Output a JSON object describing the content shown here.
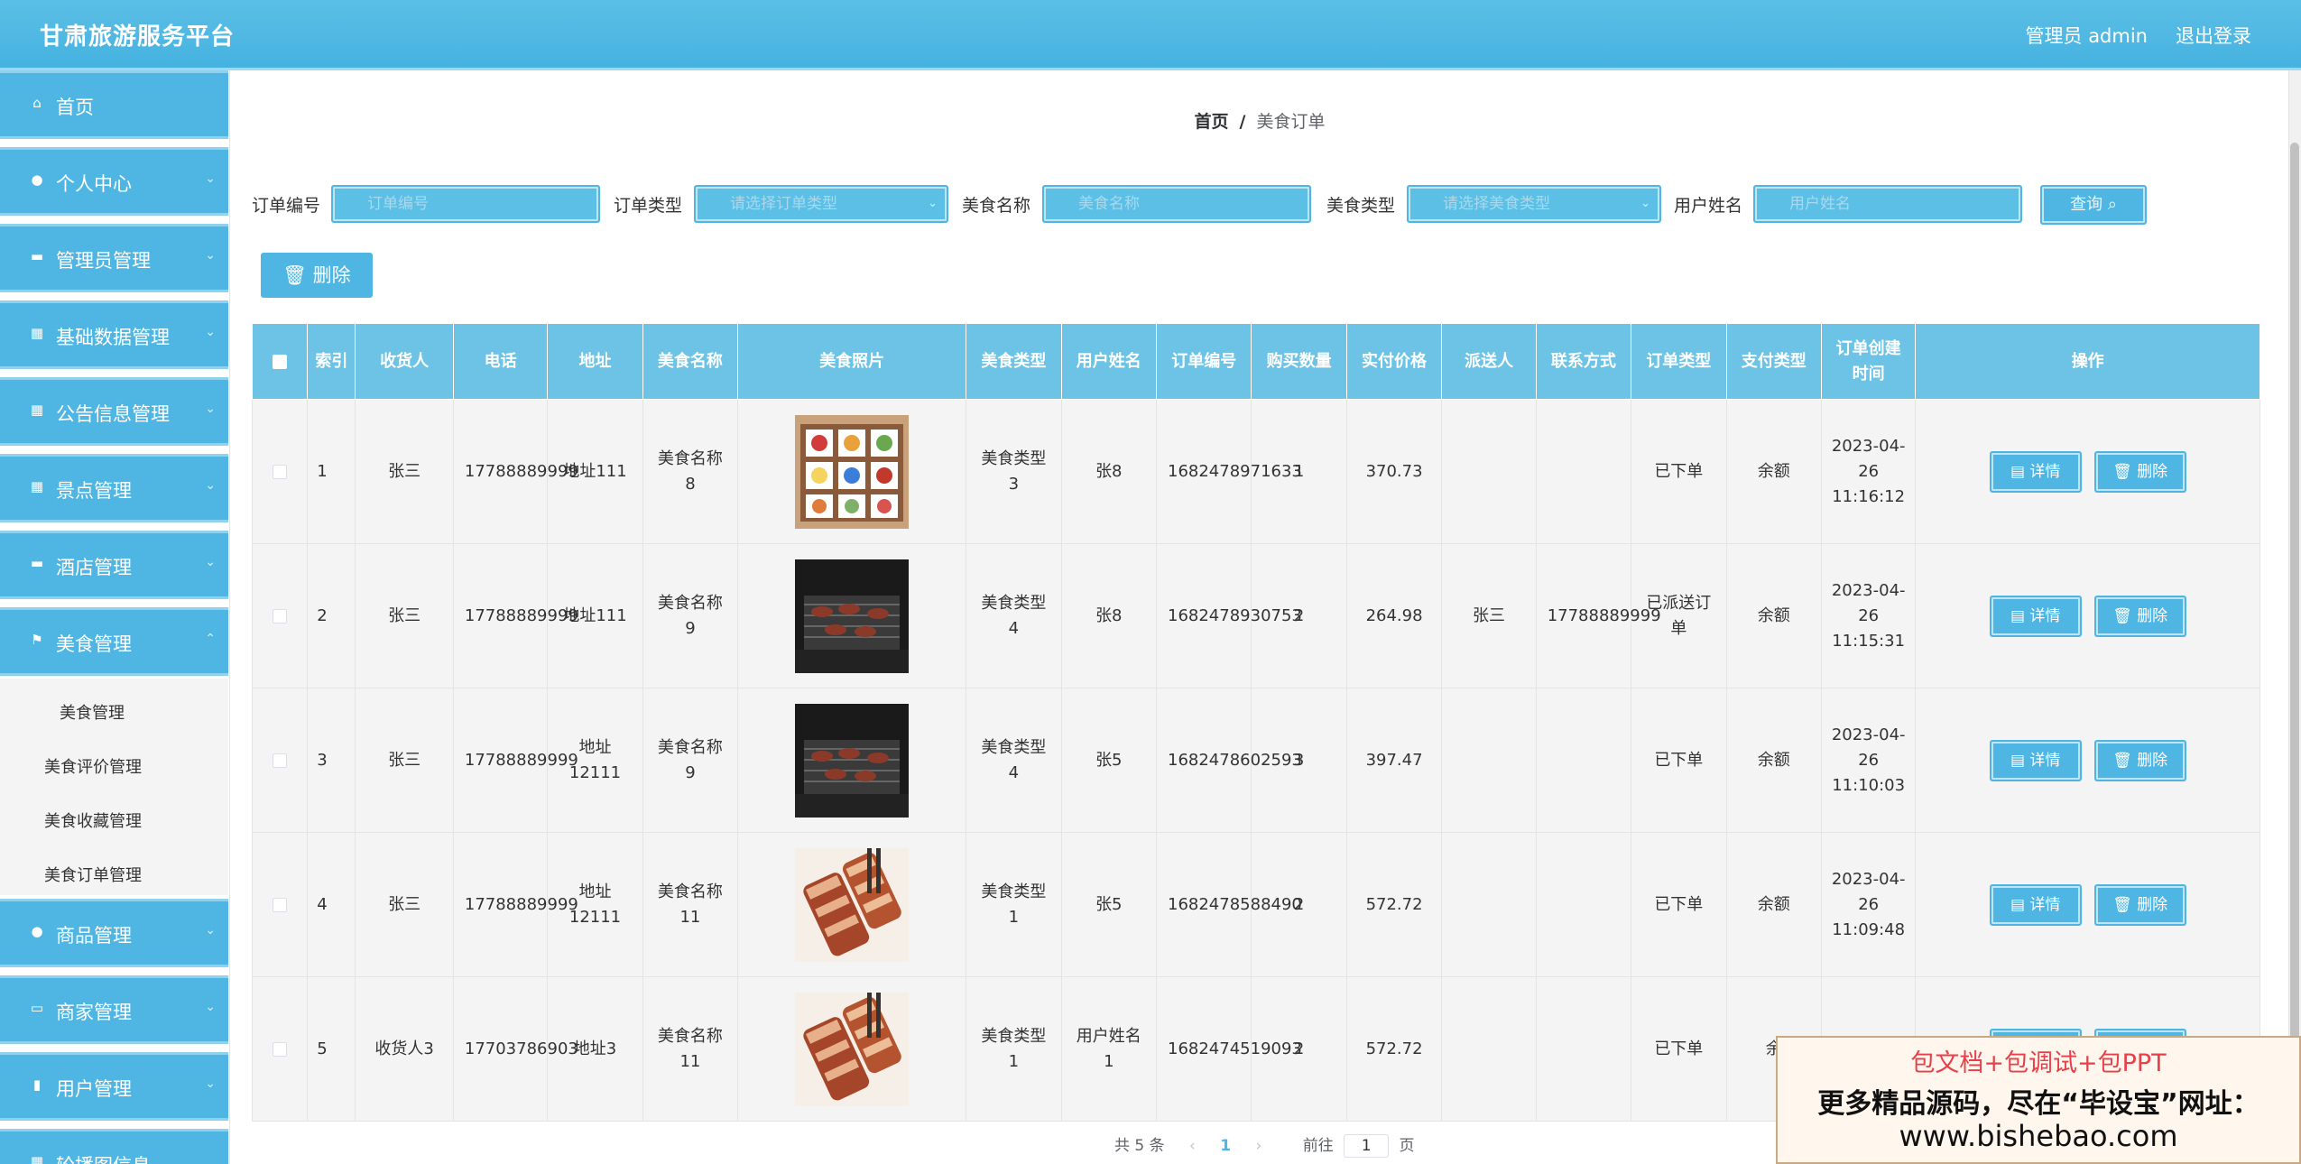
{
  "header": {
    "brand": "甘肃旅游服务平台",
    "user": "管理员 admin",
    "logout": "退出登录"
  },
  "sidebar": {
    "items": [
      {
        "label": "首页",
        "icon": "home-icon",
        "glyph": "⌂"
      },
      {
        "label": "个人中心",
        "icon": "user-icon",
        "glyph": "●"
      },
      {
        "label": "管理员管理",
        "icon": "briefcase-icon",
        "glyph": "▬"
      },
      {
        "label": "基础数据管理",
        "icon": "grid-icon",
        "glyph": "▦"
      },
      {
        "label": "公告信息管理",
        "icon": "grid-icon",
        "glyph": "▦"
      },
      {
        "label": "景点管理",
        "icon": "grid-icon",
        "glyph": "▦"
      },
      {
        "label": "酒店管理",
        "icon": "briefcase-icon",
        "glyph": "▬"
      },
      {
        "label": "美食管理",
        "icon": "flag-icon",
        "glyph": "⚑"
      },
      {
        "label": "商品管理",
        "icon": "circle-icon",
        "glyph": "●"
      },
      {
        "label": "商家管理",
        "icon": "monitor-icon",
        "glyph": "▭"
      },
      {
        "label": "用户管理",
        "icon": "bar-chart-icon",
        "glyph": "▮"
      },
      {
        "label": "轮播图信息",
        "icon": "image-icon",
        "glyph": "▦"
      }
    ],
    "sub_items": [
      "美食管理",
      "美食评价管理",
      "美食收藏管理",
      "美食订单管理"
    ]
  },
  "breadcrumb": {
    "home": "首页",
    "sep": "/",
    "current": "美食订单"
  },
  "filters": {
    "order_no_label": "订单编号",
    "order_no_placeholder": "订单编号",
    "order_type_label": "订单类型",
    "order_type_placeholder": "请选择订单类型",
    "food_name_label": "美食名称",
    "food_name_placeholder": "美食名称",
    "food_type_label": "美食类型",
    "food_type_placeholder": "请选择美食类型",
    "username_label": "用户姓名",
    "username_placeholder": "用户姓名",
    "query_label": "查询",
    "delete_label": "删除"
  },
  "table": {
    "headers": [
      "索引",
      "收货人",
      "电话",
      "地址",
      "美食名称",
      "美食照片",
      "美食类型",
      "用户姓名",
      "订单编号",
      "购买数量",
      "实付价格",
      "派送人",
      "联系方式",
      "订单类型",
      "支付类型",
      "订单创建时间",
      "操作"
    ],
    "detail_label": "详情",
    "delete_label": "删除",
    "rows": [
      {
        "idx": "1",
        "receiver": "张三",
        "phone": "17788889999",
        "addr": "地址111",
        "name": "美食名称8",
        "img": "bento",
        "ftype": "美食类型3",
        "uname": "张8",
        "order": "1682478971633",
        "qty": "1",
        "price": "370.73",
        "courier": "",
        "contact": "",
        "otype": "已下单",
        "pay": "余额",
        "time": "2023-04-26 11:16:12"
      },
      {
        "idx": "2",
        "receiver": "张三",
        "phone": "17788889999",
        "addr": "地址111",
        "name": "美食名称9",
        "img": "grill",
        "ftype": "美食类型4",
        "uname": "张8",
        "order": "1682478930753",
        "qty": "2",
        "price": "264.98",
        "courier": "张三",
        "contact": "17788889999",
        "otype": "已派送订单",
        "pay": "余额",
        "time": "2023-04-26 11:15:31"
      },
      {
        "idx": "3",
        "receiver": "张三",
        "phone": "17788889999",
        "addr": "地址12111",
        "name": "美食名称9",
        "img": "grill",
        "ftype": "美食类型4",
        "uname": "张5",
        "order": "1682478602593",
        "qty": "3",
        "price": "397.47",
        "courier": "",
        "contact": "",
        "otype": "已下单",
        "pay": "余额",
        "time": "2023-04-26 11:10:03"
      },
      {
        "idx": "4",
        "receiver": "张三",
        "phone": "17788889999",
        "addr": "地址12111",
        "name": "美食名称11",
        "img": "pork",
        "ftype": "美食类型1",
        "uname": "张5",
        "order": "1682478588490",
        "qty": "2",
        "price": "572.72",
        "courier": "",
        "contact": "",
        "otype": "已下单",
        "pay": "余额",
        "time": "2023-04-26 11:09:48"
      },
      {
        "idx": "5",
        "receiver": "收货人3",
        "phone": "17703786903",
        "addr": "地址3",
        "name": "美食名称11",
        "img": "pork",
        "ftype": "美食类型1",
        "uname": "用户姓名1",
        "order": "1682474519093",
        "qty": "2",
        "price": "572.72",
        "courier": "",
        "contact": "",
        "otype": "已下单",
        "pay": "余",
        "time": "2023-04-"
      }
    ]
  },
  "pagination": {
    "total": "共 5 条",
    "prev": "‹",
    "page": "1",
    "next": "›",
    "goto": "前往",
    "goto_value": "1",
    "page_unit": "页"
  },
  "watermark": {
    "line1": "包文档+包调试+包PPT",
    "line2": "更多精品源码，尽在“毕设宝”网址：",
    "line3": "www.bishebao.com"
  },
  "colors": {
    "primary": "#4fb6e3",
    "header": "#6cc3e6",
    "accent_red": "#e8404a"
  }
}
